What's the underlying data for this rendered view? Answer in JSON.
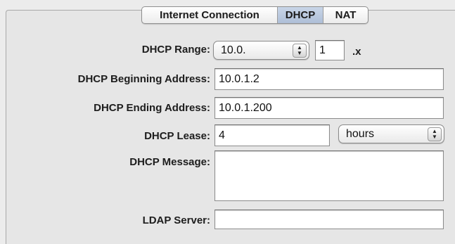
{
  "tabs": [
    {
      "label": "Internet Connection"
    },
    {
      "label": "DHCP"
    },
    {
      "label": "NAT"
    }
  ],
  "active_tab": "DHCP",
  "dhcp_range": {
    "label": "DHCP Range:",
    "popup_value": "10.0.",
    "octet_value": "1",
    "suffix": ".x"
  },
  "beginning_address": {
    "label": "DHCP Beginning Address:",
    "value": "10.0.1.2"
  },
  "ending_address": {
    "label": "DHCP Ending Address:",
    "value": "10.0.1.200"
  },
  "lease": {
    "label": "DHCP Lease:",
    "value": "4",
    "unit": "hours"
  },
  "message": {
    "label": "DHCP Message:",
    "value": ""
  },
  "ldap": {
    "label": "LDAP Server:",
    "value": ""
  },
  "icons": {
    "stepper": "up-down-arrows-icon"
  }
}
